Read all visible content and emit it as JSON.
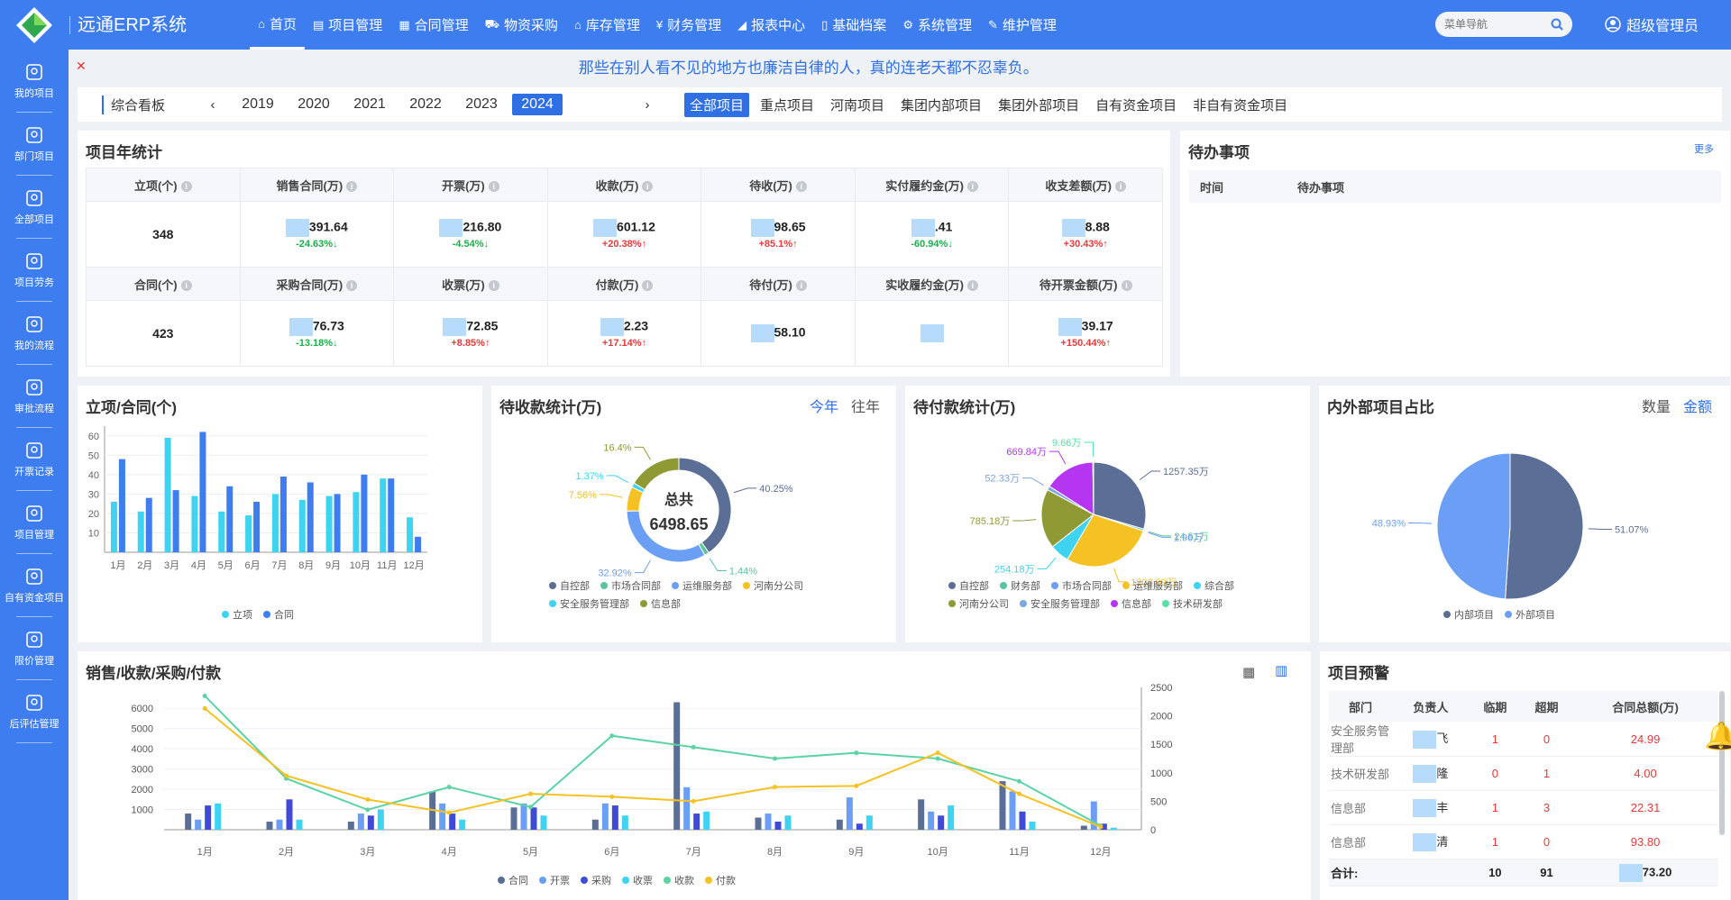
{
  "app": {
    "title": "远通ERP系统",
    "user": "超级管理员"
  },
  "nav": [
    {
      "label": "首页",
      "icon": "⌂",
      "active": true
    },
    {
      "label": "项目管理",
      "icon": "▤"
    },
    {
      "label": "合同管理",
      "icon": "▦"
    },
    {
      "label": "物资采购",
      "icon": "⛟"
    },
    {
      "label": "库存管理",
      "icon": "⌂"
    },
    {
      "label": "财务管理",
      "icon": "¥"
    },
    {
      "label": "报表中心",
      "icon": "◢"
    },
    {
      "label": "基础档案",
      "icon": "▯"
    },
    {
      "label": "系统管理",
      "icon": "⚙"
    },
    {
      "label": "维护管理",
      "icon": "✎"
    }
  ],
  "search": {
    "placeholder": "菜单导航"
  },
  "sidebar": [
    "我的项目",
    "部门项目",
    "全部项目",
    "项目劳务",
    "我的流程",
    "审批流程",
    "开票记录",
    "项目管理",
    "自有资金项目",
    "限价管理",
    "后评估管理"
  ],
  "marquee": "那些在别人看不见的地方也廉洁自律的人，真的连老天都不忍辜负。",
  "yearbar": {
    "title": "综合看板",
    "years": [
      "2019",
      "2020",
      "2021",
      "2022",
      "2023",
      "2024"
    ],
    "active_year": "2024",
    "tabs": [
      "全部项目",
      "重点项目",
      "河南项目",
      "集团内部项目",
      "集团外部项目",
      "自有资金项目",
      "非自有资金项目"
    ],
    "active_tab": "全部项目"
  },
  "stats": {
    "title": "项目年统计",
    "row1": [
      {
        "label": "立项(个)",
        "value": "348",
        "pct": "",
        "dir": ""
      },
      {
        "label": "销售合同(万)",
        "value": "391.64",
        "pct": "-24.63%↓",
        "dir": "down",
        "masked": true
      },
      {
        "label": "开票(万)",
        "value": "216.80",
        "pct": "-4.54%↓",
        "dir": "down",
        "masked": true
      },
      {
        "label": "收款(万)",
        "value": "601.12",
        "pct": "+20.38%↑",
        "dir": "up",
        "masked": true
      },
      {
        "label": "待收(万)",
        "value": "98.65",
        "pct": "+85.1%↑",
        "dir": "up",
        "masked": true
      },
      {
        "label": "实付履约金(万)",
        "value": ".41",
        "pct": "-60.94%↓",
        "dir": "down",
        "masked": true
      },
      {
        "label": "收支差额(万)",
        "value": "8.88",
        "pct": "+30.43%↑",
        "dir": "up",
        "masked": true
      }
    ],
    "row2": [
      {
        "label": "合同(个)",
        "value": "423",
        "pct": "",
        "dir": ""
      },
      {
        "label": "采购合同(万)",
        "value": "76.73",
        "pct": "-13.18%↓",
        "dir": "down",
        "masked": true
      },
      {
        "label": "收票(万)",
        "value": "72.85",
        "pct": "+8.85%↑",
        "dir": "up",
        "masked": true
      },
      {
        "label": "付款(万)",
        "value": "2.23",
        "pct": "+17.14%↑",
        "dir": "up",
        "masked": true
      },
      {
        "label": "待付(万)",
        "value": "58.10",
        "pct": "",
        "dir": "",
        "masked": true
      },
      {
        "label": "实收履约金(万)",
        "value": "",
        "pct": "",
        "dir": "",
        "masked": true
      },
      {
        "label": "待开票金额(万)",
        "value": "39.17",
        "pct": "+150.44%↑",
        "dir": "up",
        "masked": true
      }
    ]
  },
  "todo": {
    "title": "待办事项",
    "more": "更多",
    "col_time": "时间",
    "col_item": "待办事项"
  },
  "chart_data": [
    {
      "id": "project_contract",
      "type": "bar",
      "title": "立项/合同(个)",
      "categories": [
        "1月",
        "2月",
        "3月",
        "4月",
        "5月",
        "6月",
        "7月",
        "8月",
        "9月",
        "10月",
        "11月",
        "12月"
      ],
      "series": [
        {
          "name": "立项",
          "color": "#3ed3f0",
          "values": [
            26,
            21,
            59,
            29,
            21,
            19,
            30,
            27,
            29,
            31,
            38,
            18
          ]
        },
        {
          "name": "合同",
          "color": "#3d7df0",
          "values": [
            48,
            28,
            32,
            62,
            34,
            26,
            39,
            36,
            30,
            40,
            38,
            8
          ]
        }
      ],
      "yticks": [
        10,
        20,
        30,
        40,
        50,
        60
      ],
      "ylim": [
        0,
        65
      ]
    },
    {
      "id": "receivable",
      "type": "pie",
      "title": "待收款统计(万)",
      "center_label": "总共",
      "center_value": "6498.65",
      "switch": [
        "今年",
        "往年"
      ],
      "switch_active": "今年",
      "slices": [
        {
          "name": "自控部",
          "value": 40.25,
          "color": "#5b6e96",
          "label": "40.25%"
        },
        {
          "name": "市场合同部",
          "value": 1.44,
          "color": "#5bc49f",
          "label": "1.44%"
        },
        {
          "name": "运维服务部",
          "value": 32.92,
          "color": "#6b9ff5",
          "label": "32.92%"
        },
        {
          "name": "河南分公司",
          "value": 7.56,
          "color": "#f5c123",
          "label": "7.56%"
        },
        {
          "name": "安全服务管理部",
          "value": 1.37,
          "color": "#3ed3f0",
          "label": "1.37%"
        },
        {
          "name": "信息部",
          "value": 16.4,
          "color": "#8f9a35",
          "label": "16.4%"
        }
      ]
    },
    {
      "id": "payable",
      "type": "pie",
      "title": "待付款统计(万)",
      "slices": [
        {
          "name": "自控部",
          "value": 1257.35,
          "color": "#5b6e96",
          "label": "1257.35万"
        },
        {
          "name": "财务部",
          "value": 24.51,
          "color": "#5bc49f",
          "label": "24.51万"
        },
        {
          "name": "市场合同部",
          "value": 1.96,
          "color": "#6b9ff5",
          "label": "1.96万"
        },
        {
          "name": "运维服务部",
          "value": 1203.09,
          "color": "#f5c123",
          "label": "1203.09万"
        },
        {
          "name": "综合部",
          "value": 254.18,
          "color": "#3ed3f0",
          "label": "254.18万"
        },
        {
          "name": "河南分公司",
          "value": 785.18,
          "color": "#8f9a35",
          "label": "785.18万"
        },
        {
          "name": "安全服务管理部",
          "value": 52.33,
          "color": "#7ea6e0",
          "label": "52.33万"
        },
        {
          "name": "信息部",
          "value": 669.84,
          "color": "#b635f0",
          "label": "669.84万"
        },
        {
          "name": "技术研发部",
          "value": 9.66,
          "color": "#58e0a5",
          "label": "9.66万"
        }
      ]
    },
    {
      "id": "inner_outer",
      "type": "pie",
      "title": "内外部项目占比",
      "switch": [
        "数量",
        "金额"
      ],
      "switch_active": "金额",
      "slices": [
        {
          "name": "内部项目",
          "value": 51.07,
          "color": "#5b6e96",
          "label": "51.07%"
        },
        {
          "name": "外部项目",
          "value": 48.93,
          "color": "#6b9ff5",
          "label": "48.93%"
        }
      ]
    },
    {
      "id": "sales_trend",
      "type": "bar",
      "title": "销售/收款/采购/付款",
      "categories": [
        "1月",
        "2月",
        "3月",
        "4月",
        "5月",
        "6月",
        "7月",
        "8月",
        "9月",
        "10月",
        "11月",
        "12月"
      ],
      "yticks_left": [
        1000,
        2000,
        3000,
        4000,
        5000,
        6000
      ],
      "ylim_left": [
        0,
        6500
      ],
      "yticks_right": [
        0,
        500,
        1000,
        1500,
        2000,
        2500
      ],
      "ylim_right": [
        0,
        2500
      ],
      "series": [
        {
          "name": "合同",
          "color": "#5b6e96",
          "type": "bar",
          "values": [
            800,
            400,
            400,
            1900,
            1100,
            500,
            6300,
            600,
            500,
            1500,
            2400,
            200
          ]
        },
        {
          "name": "开票",
          "color": "#6b9ff5",
          "type": "bar",
          "values": [
            500,
            500,
            800,
            1300,
            1300,
            1300,
            2100,
            800,
            1600,
            900,
            1900,
            1400
          ]
        },
        {
          "name": "采购",
          "color": "#3f4bd6",
          "type": "bar",
          "values": [
            1200,
            1500,
            700,
            800,
            1100,
            1200,
            800,
            400,
            300,
            700,
            900,
            300
          ]
        },
        {
          "name": "收票",
          "color": "#3ed3f0",
          "type": "bar",
          "values": [
            1300,
            500,
            1000,
            500,
            700,
            700,
            900,
            700,
            700,
            1200,
            400,
            100
          ]
        },
        {
          "name": "收款",
          "color": "#5bd3a4",
          "type": "line",
          "axis": "right",
          "values": [
            2350,
            900,
            350,
            750,
            400,
            1650,
            1450,
            1250,
            1350,
            1250,
            850,
            70
          ]
        },
        {
          "name": "付款",
          "color": "#f5c123",
          "type": "line",
          "axis": "right",
          "values": [
            2130,
            950,
            530,
            300,
            630,
            580,
            500,
            750,
            770,
            1350,
            630,
            50
          ]
        }
      ]
    }
  ],
  "warning": {
    "title": "项目预警",
    "headers": [
      "部门",
      "负责人",
      "临期",
      "超期",
      "合同总额(万)"
    ],
    "rows": [
      {
        "dept": "安全服务管理部",
        "person": "飞",
        "near": "1",
        "over": "0",
        "amount": "24.99"
      },
      {
        "dept": "技术研发部",
        "person": "隆",
        "near": "0",
        "over": "1",
        "amount": "4.00"
      },
      {
        "dept": "信息部",
        "person": "丰",
        "near": "1",
        "over": "3",
        "amount": "22.31"
      },
      {
        "dept": "信息部",
        "person": "清",
        "near": "1",
        "over": "0",
        "amount": "93.80"
      }
    ],
    "total": {
      "label": "合计:",
      "near": "10",
      "over": "91",
      "amount": "73.20"
    }
  },
  "colors": {
    "primary": "#3d7df0",
    "up": "#e63a3a",
    "down": "#1cb04a"
  }
}
